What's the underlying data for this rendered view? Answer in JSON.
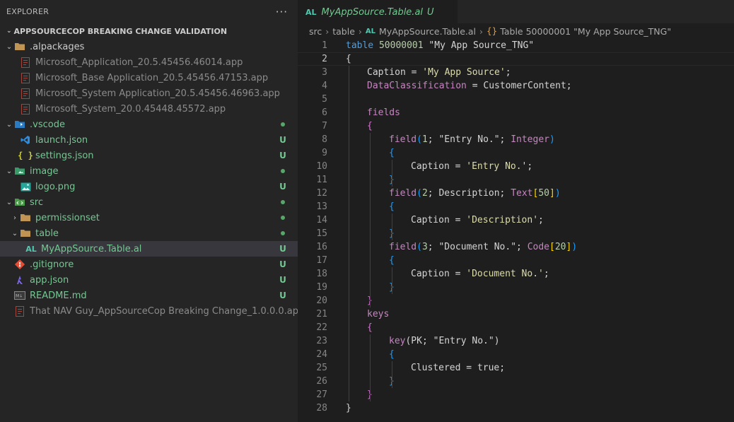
{
  "sidebar": {
    "header": "EXPLORER",
    "more_actions": "···",
    "workspace": "APPSOURCECOP BREAKING CHANGE VALIDATION",
    "items": [
      {
        "label": ".alpackages",
        "chev": "⌄",
        "icon": "folder-icon",
        "badge": "",
        "muted": false
      },
      {
        "label": "Microsoft_Application_20.5.45456.46014.app",
        "icon": "app-file-icon",
        "badge": "",
        "muted": true
      },
      {
        "label": "Microsoft_Base Application_20.5.45456.47153.app",
        "icon": "app-file-icon",
        "badge": "",
        "muted": true
      },
      {
        "label": "Microsoft_System Application_20.5.45456.46963.app",
        "icon": "app-file-icon",
        "badge": "",
        "muted": true
      },
      {
        "label": "Microsoft_System_20.0.45448.45572.app",
        "icon": "app-file-icon",
        "badge": "",
        "muted": true
      },
      {
        "label": ".vscode",
        "chev": "⌄",
        "icon": "vscode-folder-icon",
        "badge": "dot"
      },
      {
        "label": "launch.json",
        "icon": "vscode-icon",
        "badge": "U"
      },
      {
        "label": "settings.json",
        "icon": "json-icon",
        "badge": "U"
      },
      {
        "label": "image",
        "chev": "⌄",
        "icon": "image-folder-icon",
        "badge": "dot"
      },
      {
        "label": "logo.png",
        "icon": "image-icon",
        "badge": "U"
      },
      {
        "label": "src",
        "chev": "⌄",
        "icon": "src-folder-icon",
        "badge": "dot"
      },
      {
        "label": "permissionset",
        "chev": "›",
        "icon": "folder-icon",
        "badge": "dot"
      },
      {
        "label": "table",
        "chev": "⌄",
        "icon": "folder-icon",
        "badge": "dot"
      },
      {
        "label": "MyAppSource.Table.al",
        "icon": "al-file-icon",
        "badge": "U",
        "icon_text": "AL"
      },
      {
        "label": ".gitignore",
        "icon": "git-icon",
        "badge": "U"
      },
      {
        "label": "app.json",
        "icon": "app-json-icon",
        "badge": "U"
      },
      {
        "label": "README.md",
        "icon": "markdown-icon",
        "badge": "U"
      },
      {
        "label": "That NAV Guy_AppSourceCop Breaking Change_1.0.0.0.app",
        "icon": "app-file-icon",
        "badge": "",
        "muted": true
      }
    ]
  },
  "editor": {
    "tab": {
      "icon_text": "AL",
      "name": "MyAppSource.Table.al",
      "status": "U",
      "close": "×"
    },
    "breadcrumb": {
      "parts": [
        "src",
        "table",
        "MyAppSource.Table.al",
        "Table 50000001 \"My App Source_TNG\""
      ],
      "file_icon": "AL",
      "symbol_icon": "{}"
    },
    "lines": [
      "1",
      "2",
      "3",
      "4",
      "5",
      "6",
      "7",
      "8",
      "9",
      "10",
      "11",
      "12",
      "13",
      "14",
      "15",
      "16",
      "17",
      "18",
      "19",
      "20",
      "21",
      "22",
      "23",
      "24",
      "25",
      "26",
      "27",
      "28"
    ]
  },
  "code": {
    "l1": [
      "table",
      " ",
      "50000001",
      " \"My App Source_TNG\""
    ],
    "l3": [
      "Caption",
      " = ",
      "'My App Source'",
      ";"
    ],
    "l4": [
      "DataClassification",
      " = ",
      "CustomerContent",
      ";"
    ],
    "l6": "fields",
    "l8": [
      "field",
      "(",
      "1",
      "; \"Entry No.\"; ",
      "Integer",
      ")"
    ],
    "l10": [
      "Caption",
      " = ",
      "'Entry No.'",
      ";"
    ],
    "l12": [
      "field",
      "(",
      "2",
      "; Description; ",
      "Text",
      "[",
      "50",
      "]",
      ")"
    ],
    "l14": [
      "Caption",
      " = ",
      "'Description'",
      ";"
    ],
    "l16": [
      "field",
      "(",
      "3",
      "; \"Document No.\"; ",
      "Code",
      "[",
      "20",
      "]",
      ")"
    ],
    "l18": [
      "Caption",
      " = ",
      "'Document No.'",
      ";"
    ],
    "l21": "keys",
    "l23": [
      "key",
      "(PK; \"Entry No.\")"
    ],
    "l25": [
      "Clustered",
      " = ",
      "true",
      ";"
    ],
    "open_brace": "{",
    "close_brace": "}"
  }
}
